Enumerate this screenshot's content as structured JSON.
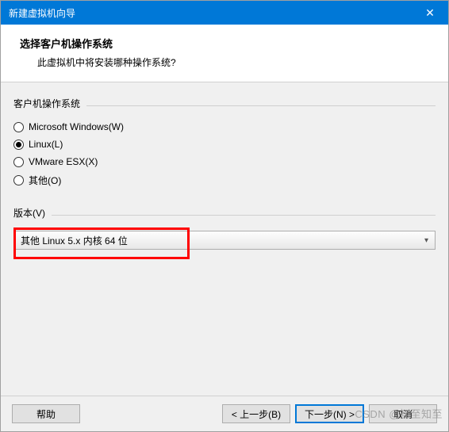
{
  "titlebar": {
    "title": "新建虚拟机向导",
    "close_glyph": "✕"
  },
  "header": {
    "title": "选择客户机操作系统",
    "subtitle": "此虚拟机中将安装哪种操作系统?"
  },
  "os_group": {
    "label": "客户机操作系统",
    "options": [
      {
        "label": "Microsoft Windows(W)",
        "checked": false
      },
      {
        "label": "Linux(L)",
        "checked": true
      },
      {
        "label": "VMware ESX(X)",
        "checked": false
      },
      {
        "label": "其他(O)",
        "checked": false
      }
    ]
  },
  "version_group": {
    "label": "版本(V)",
    "selected": "其他 Linux 5.x 内核 64 位"
  },
  "footer": {
    "help": "帮助",
    "back": "< 上一步(B)",
    "next": "下一步(N) >",
    "cancel": "取消"
  },
  "watermark": "CSDN @知至知至"
}
